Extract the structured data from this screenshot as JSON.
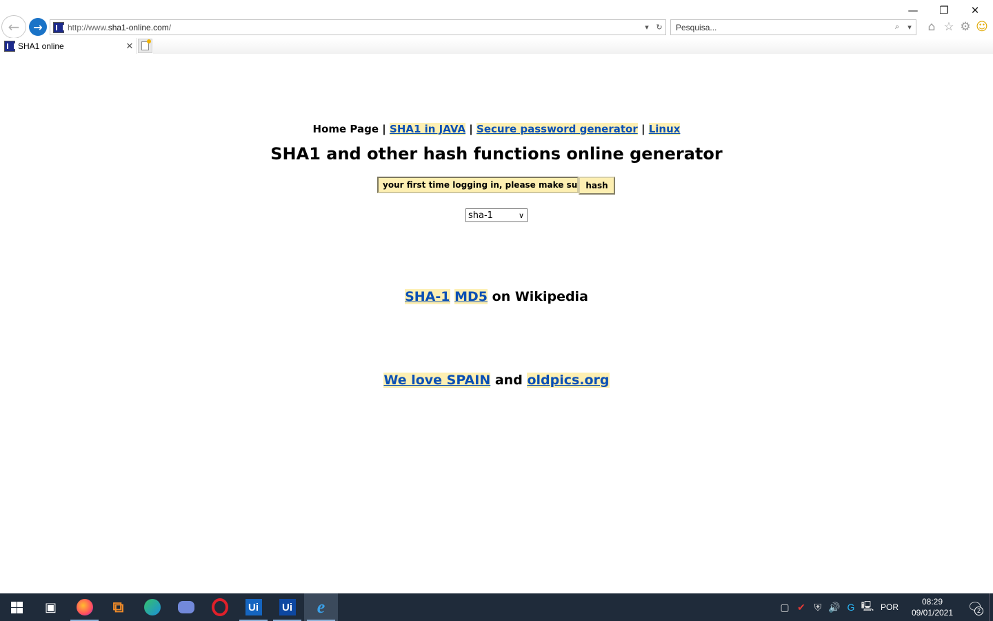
{
  "browser": {
    "address_url_prefix": "http://www.",
    "address_url_domain": "sha1-online.com",
    "address_url_suffix": "/",
    "search_placeholder": "Pesquisa...",
    "tab_title": "SHA1 online"
  },
  "page": {
    "nav": {
      "home": "Home Page",
      "sep": "|",
      "links": [
        "SHA1 in JAVA",
        "Secure password generator",
        "Linux"
      ]
    },
    "title": "SHA1 and other hash functions online generator",
    "input_value": "your first time logging in, please make sure t",
    "hash_button": "hash",
    "algorithm_selected": "sha-1",
    "wiki_links": [
      "SHA-1",
      "MD5"
    ],
    "wiki_suffix": "on Wikipedia",
    "spain_link": "We love SPAIN",
    "and_text": "and",
    "oldpics_link": "oldpics.org"
  },
  "taskbar": {
    "language": "POR",
    "time": "08:29",
    "date": "09/01/2021",
    "notification_count": "2",
    "ui_label": "Ui"
  },
  "colors": {
    "link": "#0b50b4",
    "link_bg": "#fdefb2",
    "taskbar": "#1f2b3a",
    "ie_accent": "#1a73c7"
  }
}
